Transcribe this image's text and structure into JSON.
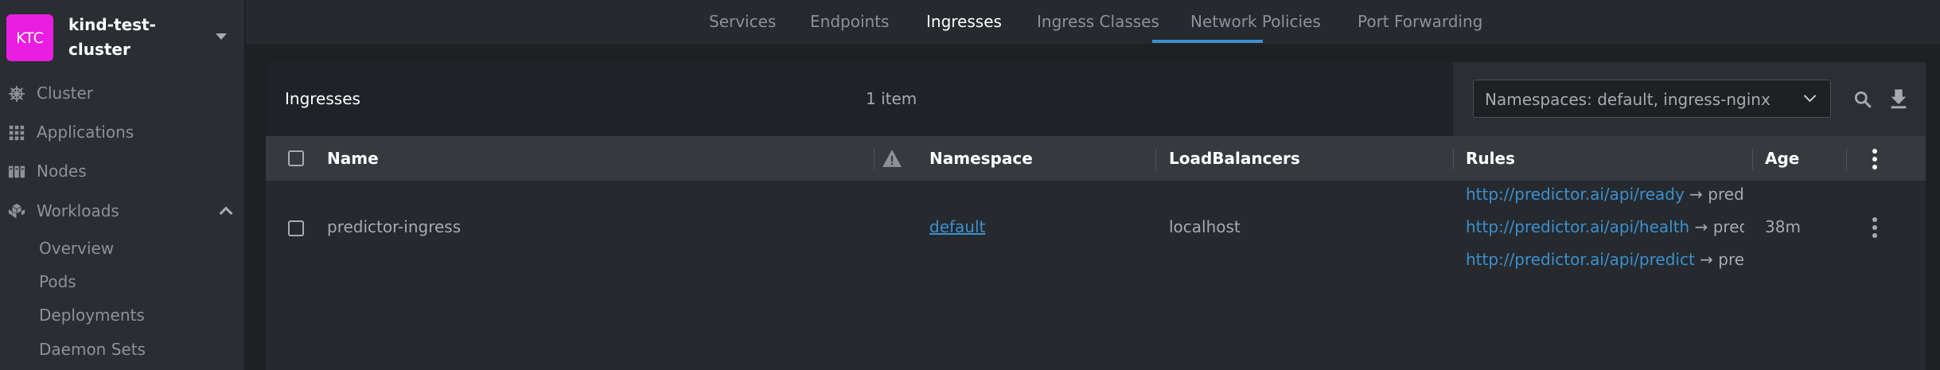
{
  "cluster": {
    "badge": "KTC",
    "name": "kind-test-cluster"
  },
  "sidebar": {
    "items": [
      {
        "label": "Cluster",
        "icon": "helm-icon"
      },
      {
        "label": "Applications",
        "icon": "apps-grid-icon"
      },
      {
        "label": "Nodes",
        "icon": "nodes-icon"
      },
      {
        "label": "Workloads",
        "icon": "workloads-icon",
        "expanded": true
      }
    ],
    "sub_items": [
      "Overview",
      "Pods",
      "Deployments",
      "Daemon Sets"
    ]
  },
  "tabs": [
    {
      "label": "Services"
    },
    {
      "label": "Endpoints"
    },
    {
      "label": "Ingresses",
      "active": true
    },
    {
      "label": "Ingress Classes"
    },
    {
      "label": "Network Policies"
    },
    {
      "label": "Port Forwarding"
    }
  ],
  "panel": {
    "title": "Ingresses",
    "count": "1 item",
    "namespace_filter": "Namespaces: default, ingress-nginx"
  },
  "table": {
    "columns": [
      "Name",
      "Namespace",
      "LoadBalancers",
      "Rules",
      "Age"
    ],
    "rows": [
      {
        "name": "predictor-ingress",
        "namespace": "default",
        "loadbalancers": "localhost",
        "rules": [
          {
            "url": "http://predictor.ai/api/ready",
            "arrow": "→",
            "target": "predictor-service"
          },
          {
            "url": "http://predictor.ai/api/health",
            "arrow": "→",
            "target": "predictor-service"
          },
          {
            "url": "http://predictor.ai/api/predict",
            "arrow": "→",
            "target": "predictor-service"
          }
        ],
        "age": "38m"
      }
    ]
  },
  "colors": {
    "accent": "#3d90ce",
    "badge": "#e91ee0",
    "warning": "#8e9297"
  }
}
